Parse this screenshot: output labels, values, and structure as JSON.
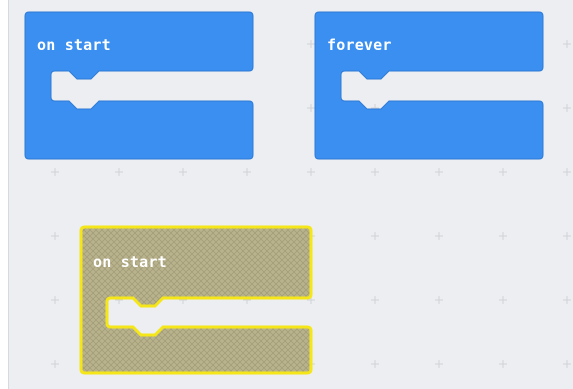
{
  "workspace": {
    "background": "#eceef1",
    "grid_color": "#cfd2d7"
  },
  "blocks": [
    {
      "id": "on-start",
      "label": "on start",
      "color": "#3a8ff0",
      "icon": "none"
    },
    {
      "id": "forever",
      "label": "forever",
      "color": "#3a8ff0",
      "icon": "none"
    },
    {
      "id": "on-start-dragged",
      "label": "on start",
      "state": "disabled-duplicate",
      "color": "#b7b18a",
      "outline": "#f5e61a"
    }
  ]
}
